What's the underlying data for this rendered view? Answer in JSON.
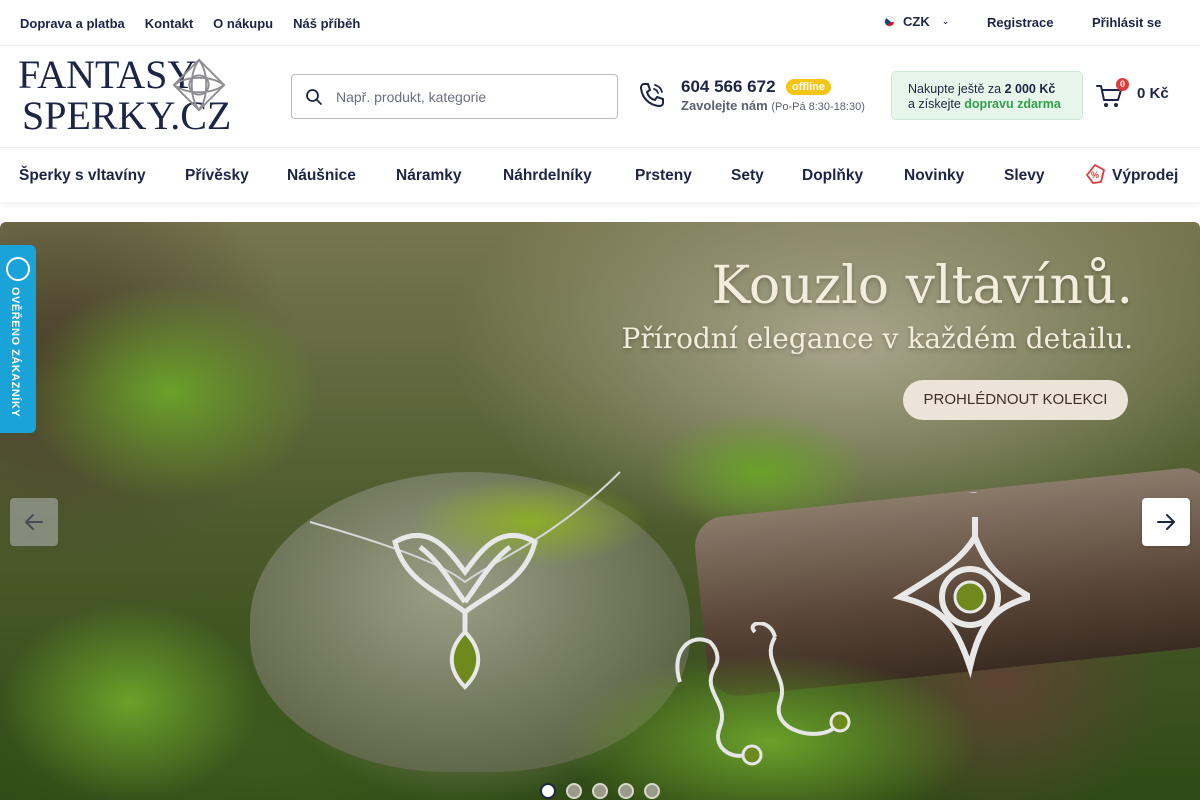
{
  "topbar": {
    "links": [
      "Doprava a platba",
      "Kontakt",
      "O nákupu",
      "Náš příběh"
    ],
    "currency": "CZK",
    "register": "Registrace",
    "login": "Přihlásit se"
  },
  "header": {
    "logo_line1": "FANTASY",
    "logo_line2": "SPERKY.CZ",
    "search_placeholder": "Např. produkt, kategorie",
    "phone": "604 566 672",
    "phone_status": "offline",
    "call_label": "Zavolejte nám",
    "call_hours": "(Po-Pá 8:30-18:30)",
    "free_ship_prefix": "Nakupte ještě za ",
    "free_ship_amount": "2 000 Kč",
    "free_ship_middle": "a získejte ",
    "free_ship_link": "dopravu zdarma",
    "cart_count": "0",
    "cart_total": "0 Kč"
  },
  "nav": {
    "items": [
      "Šperky s vltavíny",
      "Přívěsky",
      "Náušnice",
      "Náramky",
      "Náhrdelníky",
      "Prsteny",
      "Sety",
      "Doplňky",
      "Novinky",
      "Slevy",
      "Výprodej"
    ]
  },
  "hero": {
    "title": "Kouzlo vltavínů.",
    "subtitle": "Přírodní elegance v každém detailu.",
    "cta": "PROHLÉDNOUT KOLEKCI",
    "slide_count": 5,
    "active_slide": 1
  },
  "verified": {
    "label": "OVĚŘENO ZÁKAZNÍKY"
  },
  "colors": {
    "navy": "#1d2546",
    "offline_badge": "#f5c518",
    "free_ship_green": "#2fa24a",
    "verified_blue": "#1aa3d8",
    "cart_badge": "#e03b3b"
  }
}
